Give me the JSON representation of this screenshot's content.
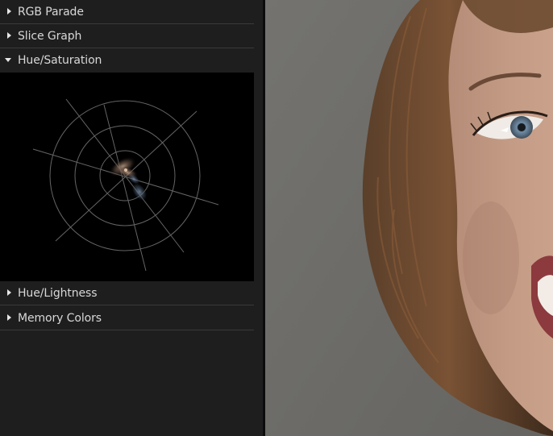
{
  "scopes_panel": {
    "sections": [
      {
        "label": "RGB Parade",
        "expanded": false
      },
      {
        "label": "Slice Graph",
        "expanded": false
      },
      {
        "label": "Hue/Saturation",
        "expanded": true
      },
      {
        "label": "Hue/Lightness",
        "expanded": false
      },
      {
        "label": "Memory Colors",
        "expanded": false
      }
    ]
  },
  "colors": {
    "panel_bg": "#1e1e1e",
    "scope_bg": "#000000",
    "divider": "#3a3a3a",
    "text": "#d8d8d8"
  },
  "viewer": {
    "content": "video-frame"
  }
}
